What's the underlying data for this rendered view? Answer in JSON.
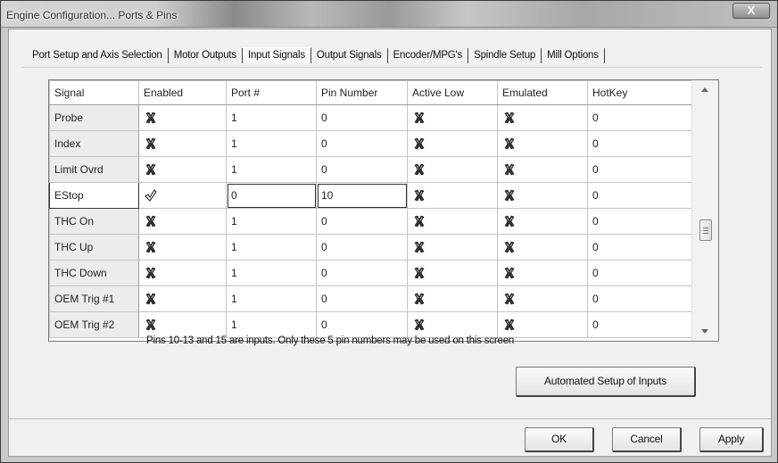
{
  "window": {
    "title": "Engine Configuration... Ports & Pins",
    "close_label": "X"
  },
  "tabs": [
    {
      "label": "Port Setup and Axis Selection",
      "active": false
    },
    {
      "label": "Motor Outputs",
      "active": false
    },
    {
      "label": "Input Signals",
      "active": true
    },
    {
      "label": "Output Signals",
      "active": false
    },
    {
      "label": "Encoder/MPG's",
      "active": false
    },
    {
      "label": "Spindle Setup",
      "active": false
    },
    {
      "label": "Mill Options",
      "active": false
    }
  ],
  "grid": {
    "columns": [
      "Signal",
      "Enabled",
      "Port #",
      "Pin Number",
      "Active Low",
      "Emulated",
      "HotKey"
    ],
    "rows": [
      {
        "signal": "Probe",
        "enabled": false,
        "port": "1",
        "pin": "0",
        "active_low": false,
        "emulated": false,
        "hotkey": "0"
      },
      {
        "signal": "Index",
        "enabled": false,
        "port": "1",
        "pin": "0",
        "active_low": false,
        "emulated": false,
        "hotkey": "0"
      },
      {
        "signal": "Limit Ovrd",
        "enabled": false,
        "port": "1",
        "pin": "0",
        "active_low": false,
        "emulated": false,
        "hotkey": "0"
      },
      {
        "signal": "EStop",
        "enabled": true,
        "port": "0",
        "pin": "10",
        "active_low": false,
        "emulated": false,
        "hotkey": "0"
      },
      {
        "signal": "THC On",
        "enabled": false,
        "port": "1",
        "pin": "0",
        "active_low": false,
        "emulated": false,
        "hotkey": "0"
      },
      {
        "signal": "THC Up",
        "enabled": false,
        "port": "1",
        "pin": "0",
        "active_low": false,
        "emulated": false,
        "hotkey": "0"
      },
      {
        "signal": "THC Down",
        "enabled": false,
        "port": "1",
        "pin": "0",
        "active_low": false,
        "emulated": false,
        "hotkey": "0"
      },
      {
        "signal": "OEM Trig #1",
        "enabled": false,
        "port": "1",
        "pin": "0",
        "active_low": false,
        "emulated": false,
        "hotkey": "0"
      },
      {
        "signal": "OEM Trig #2",
        "enabled": false,
        "port": "1",
        "pin": "0",
        "active_low": false,
        "emulated": false,
        "hotkey": "0"
      }
    ],
    "icons": {
      "on": "green-check-icon",
      "off": "red-x-icon"
    }
  },
  "note": "Pins 10-13 and 15 are inputs. Only these 5 pin numbers may be used on this screen",
  "buttons": {
    "auto_setup": "Automated Setup of Inputs",
    "ok": "OK",
    "cancel": "Cancel",
    "apply": "Apply"
  }
}
